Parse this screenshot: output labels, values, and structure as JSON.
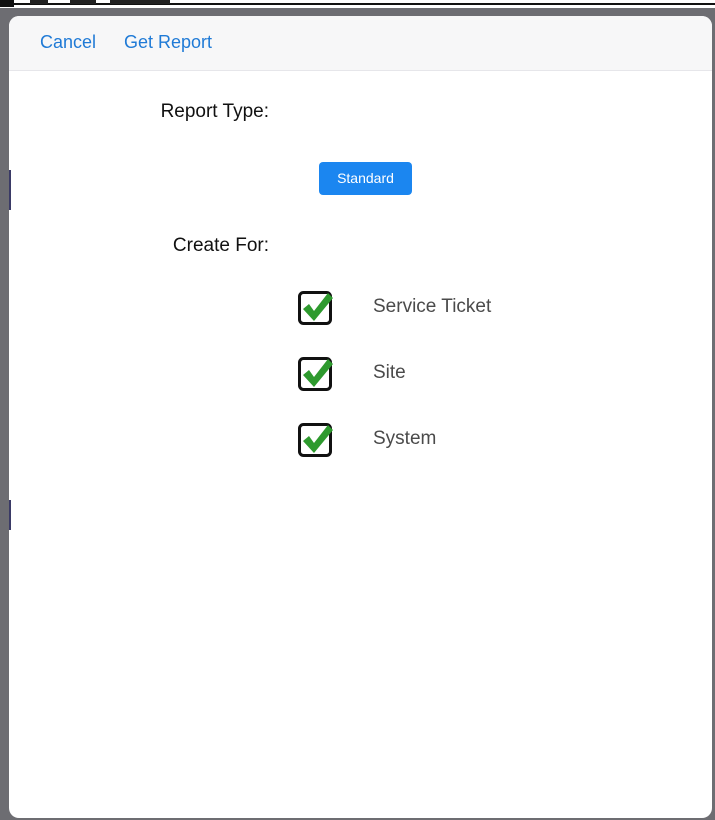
{
  "navbar": {
    "cancel_label": "Cancel",
    "get_report_label": "Get Report"
  },
  "report_type": {
    "label": "Report Type:",
    "selected": "Standard"
  },
  "create_for": {
    "label": "Create For:",
    "options": [
      {
        "label": "Service Ticket",
        "checked": true
      },
      {
        "label": "Site",
        "checked": true
      },
      {
        "label": "System",
        "checked": true
      }
    ]
  },
  "colors": {
    "accent": "#1f7ad6",
    "button": "#1b86f0",
    "check": "#2e9a2e",
    "backdrop": "#6d6d72"
  }
}
